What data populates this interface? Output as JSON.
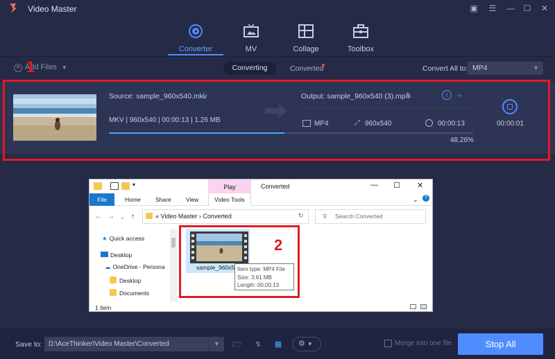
{
  "app": {
    "title": "Video Master"
  },
  "nav": [
    {
      "label": "Converter",
      "icon": "converter-icon",
      "active": true
    },
    {
      "label": "MV",
      "icon": "mv-icon",
      "active": false
    },
    {
      "label": "Collage",
      "icon": "collage-icon",
      "active": false
    },
    {
      "label": "Toolbox",
      "icon": "toolbox-icon",
      "active": false
    }
  ],
  "toolbar": {
    "add_files": "Add Files",
    "seg_converting": "Converting",
    "seg_converted": "Converted",
    "convert_all_label": "Convert All to:",
    "convert_all_value": "MP4"
  },
  "file": {
    "source": "Source: sample_960x540.mkv",
    "meta": "MKV | 960x540 | 00:00:13 | 1.26 MB",
    "output": "Output: sample_960x540 (3).mp4",
    "out_format": "MP4",
    "out_resolution": "960x540",
    "out_duration": "00:00:13",
    "progress_text": "48.26%",
    "progress": 0.4826,
    "elapsed": "00:00:01"
  },
  "annotations": {
    "box1": "1",
    "box2": "2"
  },
  "explorer": {
    "play_tab": "Play",
    "title": "Converted",
    "ribbon": {
      "file": "File",
      "home": "Home",
      "share": "Share",
      "view": "View",
      "video_tools": "Video Tools"
    },
    "address": "« Video Master › Converted",
    "search_placeholder": "Search Converted",
    "nav": {
      "quick_access": "Quick access",
      "desktop": "Desktop",
      "onedrive": "OneDrive - Persona",
      "desktop2": "Desktop",
      "documents": "Documents"
    },
    "file_name": "sample_960x5",
    "tooltip": {
      "type": "Item type: MP4 File",
      "size": "Size: 3.61 MB",
      "length": "Length: 00:00:13"
    },
    "status": "1 item"
  },
  "bottom": {
    "save_to": "Save to:",
    "path": "D:\\AceThinker\\Video Master\\Converted",
    "merge": "Merge into one file",
    "stop_all": "Stop All"
  },
  "colors": {
    "accent": "#4f8dff",
    "annotation": "#e31b23",
    "background": "#252a46"
  }
}
